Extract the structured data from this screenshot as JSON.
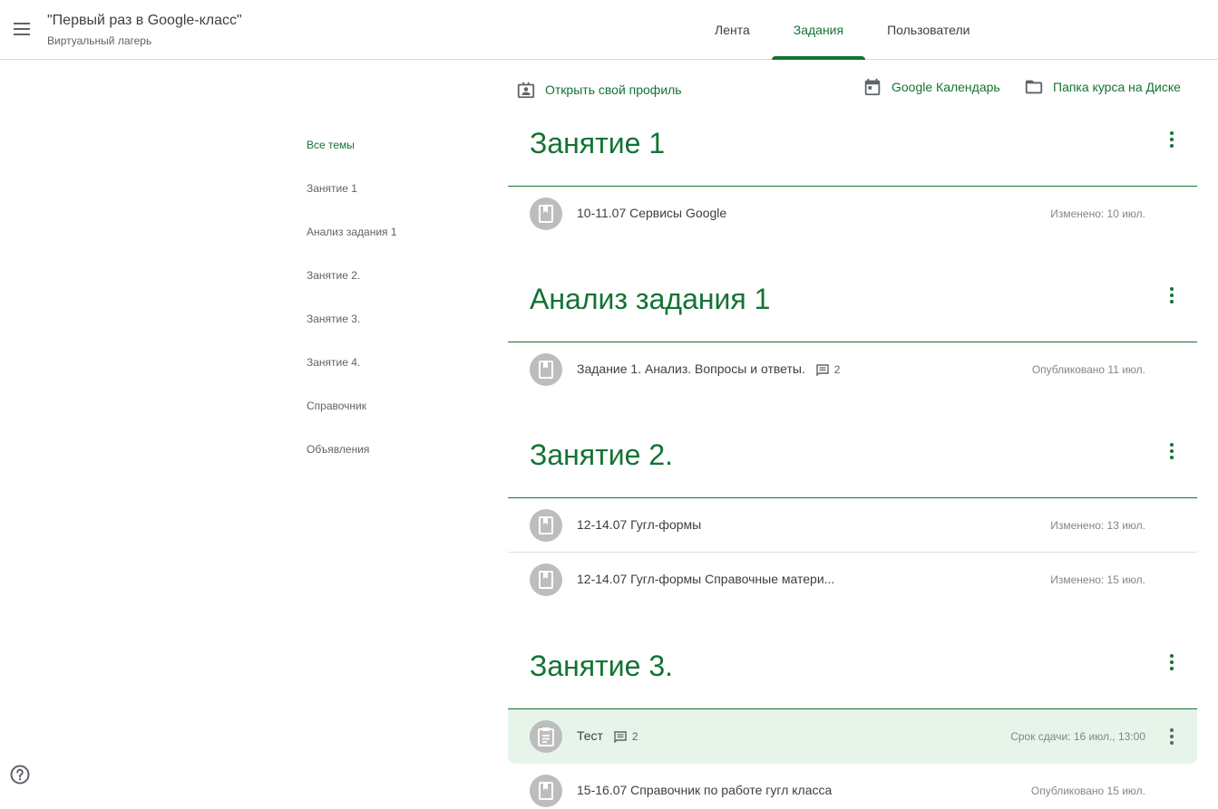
{
  "header": {
    "course_title": "\"Первый раз в Google-класс\"",
    "course_subtitle": "Виртуальный лагерь",
    "tabs": [
      {
        "label": "Лента"
      },
      {
        "label": "Задания"
      },
      {
        "label": "Пользователи"
      }
    ],
    "active_tab": "Задания"
  },
  "toolbar": {
    "profile_label": "Открыть свой профиль",
    "calendar_label": "Google Календарь",
    "drive_label": "Папка курса на Диске"
  },
  "topics": [
    {
      "label": "Все темы"
    },
    {
      "label": "Занятие 1"
    },
    {
      "label": "Анализ задания 1"
    },
    {
      "label": "Занятие 2."
    },
    {
      "label": "Занятие 3."
    },
    {
      "label": "Занятие 4."
    },
    {
      "label": "Справочник"
    },
    {
      "label": "Объявления"
    }
  ],
  "sections": [
    {
      "title": "Занятие 1",
      "items": [
        {
          "title": "10-11.07 Сервисы Google",
          "meta": "Изменено: 10 июл.",
          "icon": "material-icon"
        }
      ]
    },
    {
      "title": "Анализ задания 1",
      "items": [
        {
          "title": "Задание 1. Анализ. Вопросы и ответы.",
          "comments": "2",
          "meta": "Опубликовано 11 июл.",
          "icon": "material-icon"
        }
      ]
    },
    {
      "title": "Занятие 2.",
      "items": [
        {
          "title": "12-14.07 Гугл-формы",
          "meta": "Изменено: 13 июл.",
          "icon": "material-icon"
        },
        {
          "title": "12-14.07 Гугл-формы Справочные матери...",
          "meta": "Изменено: 15 июл.",
          "icon": "material-icon"
        }
      ]
    },
    {
      "title": "Занятие 3.",
      "items": [
        {
          "title": "Тест",
          "comments": "2",
          "meta": "Срок сдачи: 16 июл., 13:00",
          "icon": "assignment-icon"
        },
        {
          "title": "15-16.07 Справочник по работе гугл класса",
          "meta": "Опубликовано 15 июл.",
          "icon": "material-icon"
        }
      ]
    }
  ],
  "colors": {
    "accent": "#137333",
    "highlight": "#e6f4ea",
    "icon_bg": "#bdbdbd"
  }
}
